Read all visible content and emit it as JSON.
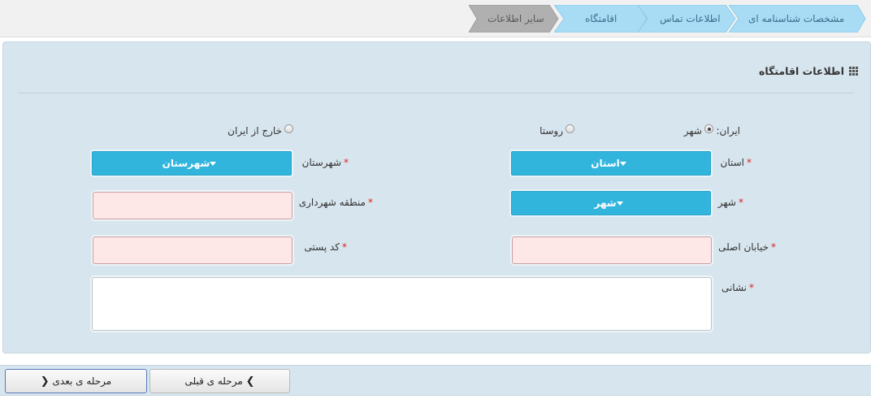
{
  "wizard": {
    "steps": [
      {
        "label": "مشخصات شناسنامه ای",
        "state": "done"
      },
      {
        "label": "اطلاعات تماس",
        "state": "done"
      },
      {
        "label": "اقامتگاه",
        "state": "current"
      },
      {
        "label": "سایر اطلاعات",
        "state": "pending"
      }
    ]
  },
  "colors": {
    "step_done": "#a8dcf5",
    "step_pending": "#b0b0b0",
    "dropdown": "#31b5dd",
    "required_field_bg": "#fde7e7",
    "panel_bg": "#d7e5ee"
  },
  "section": {
    "title": "اطلاعات اقامتگاه",
    "icon": "grid-icon"
  },
  "form": {
    "location_type": {
      "label": "ایران:",
      "options": [
        {
          "label": "شهر",
          "checked": true
        },
        {
          "label": "روستا",
          "checked": false
        },
        {
          "label": "خارج از ایران",
          "checked": false
        }
      ]
    },
    "province": {
      "label": "استان",
      "required_mark": "*",
      "selected": "استان"
    },
    "county": {
      "label": "شهرستان",
      "required_mark": "*",
      "selected": "شهرستان"
    },
    "city": {
      "label": "شهر",
      "required_mark": "*",
      "selected": "شهر"
    },
    "municipal_district": {
      "label": "منطقه شهرداری",
      "required_mark": "*",
      "value": ""
    },
    "main_street": {
      "label": "خیابان اصلی",
      "required_mark": "*",
      "value": ""
    },
    "postal_code": {
      "label": "کد پستی",
      "required_mark": "*",
      "value": ""
    },
    "address": {
      "label": "نشانی",
      "required_mark": "*",
      "value": ""
    }
  },
  "footer": {
    "next_label": "مرحله ی بعدی",
    "prev_label": "مرحله ی قبلی"
  }
}
